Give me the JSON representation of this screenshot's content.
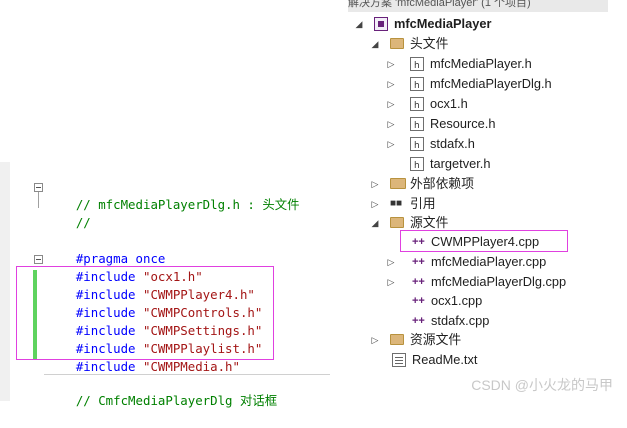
{
  "editor": {
    "lines": [
      {
        "comment": "// mfcMediaPlayerDlg.h : 头文件"
      },
      {
        "comment": "//"
      },
      {
        "pre": "#pragma once"
      },
      {
        "pre": "#include",
        "str": "\"ocx1.h\""
      },
      {
        "pre": "#include",
        "str": "\"CWMPPlayer4.h\""
      },
      {
        "pre": "#include",
        "str": "\"CWMPControls.h\""
      },
      {
        "pre": "#include",
        "str": "\"CWMPSettings.h\""
      },
      {
        "pre": "#include",
        "str": "\"CWMPPlaylist.h\""
      },
      {
        "pre": "#include",
        "str": "\"CWMPMedia.h\""
      },
      {
        "comment": "// CmfcMediaPlayerDlg 对话框"
      }
    ]
  },
  "explorer": {
    "title_partial": "解决方案 'mfcMediaPlayer' (1 个项目)",
    "project": "mfcMediaPlayer",
    "header_folder": "头文件",
    "header_files": [
      "mfcMediaPlayer.h",
      "mfcMediaPlayerDlg.h",
      "ocx1.h",
      "Resource.h",
      "stdafx.h",
      "targetver.h"
    ],
    "external_deps": "外部依赖项",
    "references": "引用",
    "source_folder": "源文件",
    "source_files": [
      "CWMPPlayer4.cpp",
      "mfcMediaPlayer.cpp",
      "mfcMediaPlayerDlg.cpp",
      "ocx1.cpp",
      "stdafx.cpp"
    ],
    "resource_folder": "资源文件",
    "readme": "ReadMe.txt"
  },
  "icons": {
    "expanded_arrow": "◢",
    "collapsed_arrow": "▷",
    "cpp_glyph": "++"
  },
  "colors": {
    "highlight_box": "#e040e0",
    "change_bar": "#5fd35f",
    "comment": "#008000",
    "keyword": "#0000ff",
    "string": "#a31515"
  },
  "watermark": "CSDN @小火龙的马甲"
}
